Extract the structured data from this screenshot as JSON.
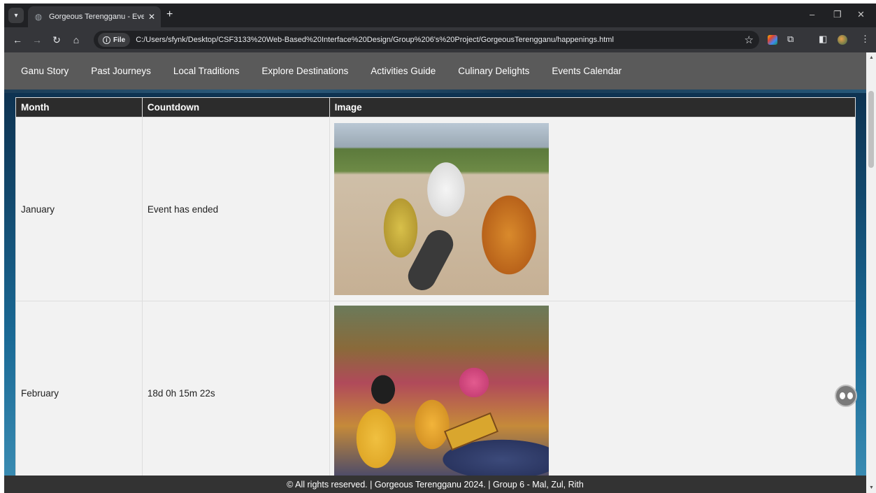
{
  "browser": {
    "tab_title": "Gorgeous Terengganu - Events",
    "tab_close": "✕",
    "new_tab": "+",
    "file_chip": "File",
    "url": "C:/Users/sfynk/Desktop/CSF3133%20Web-Based%20Interface%20Design/Group%206's%20Project/GorgeousTerengganu/happenings.html",
    "window_controls": {
      "minimize": "–",
      "restore": "❐",
      "close": "✕"
    }
  },
  "nav": {
    "items": [
      "Ganu Story",
      "Past Journeys",
      "Local Traditions",
      "Explore Destinations",
      "Activities Guide",
      "Culinary Delights",
      "Events Calendar"
    ]
  },
  "table": {
    "headers": [
      "Month",
      "Countdown",
      "Image"
    ],
    "rows": [
      {
        "month": "January",
        "countdown": "Event has ended"
      },
      {
        "month": "February",
        "countdown": "18d 0h 15m 22s"
      }
    ]
  },
  "footer": {
    "text": "© All rights reserved. | Gorgeous Terengganu 2024. | Group 6 - Mal, Zul, Rith"
  },
  "colors": {
    "nav_bg": "#5a5a5a",
    "table_header_bg": "#2c2c2c",
    "footer_bg": "#333333"
  }
}
